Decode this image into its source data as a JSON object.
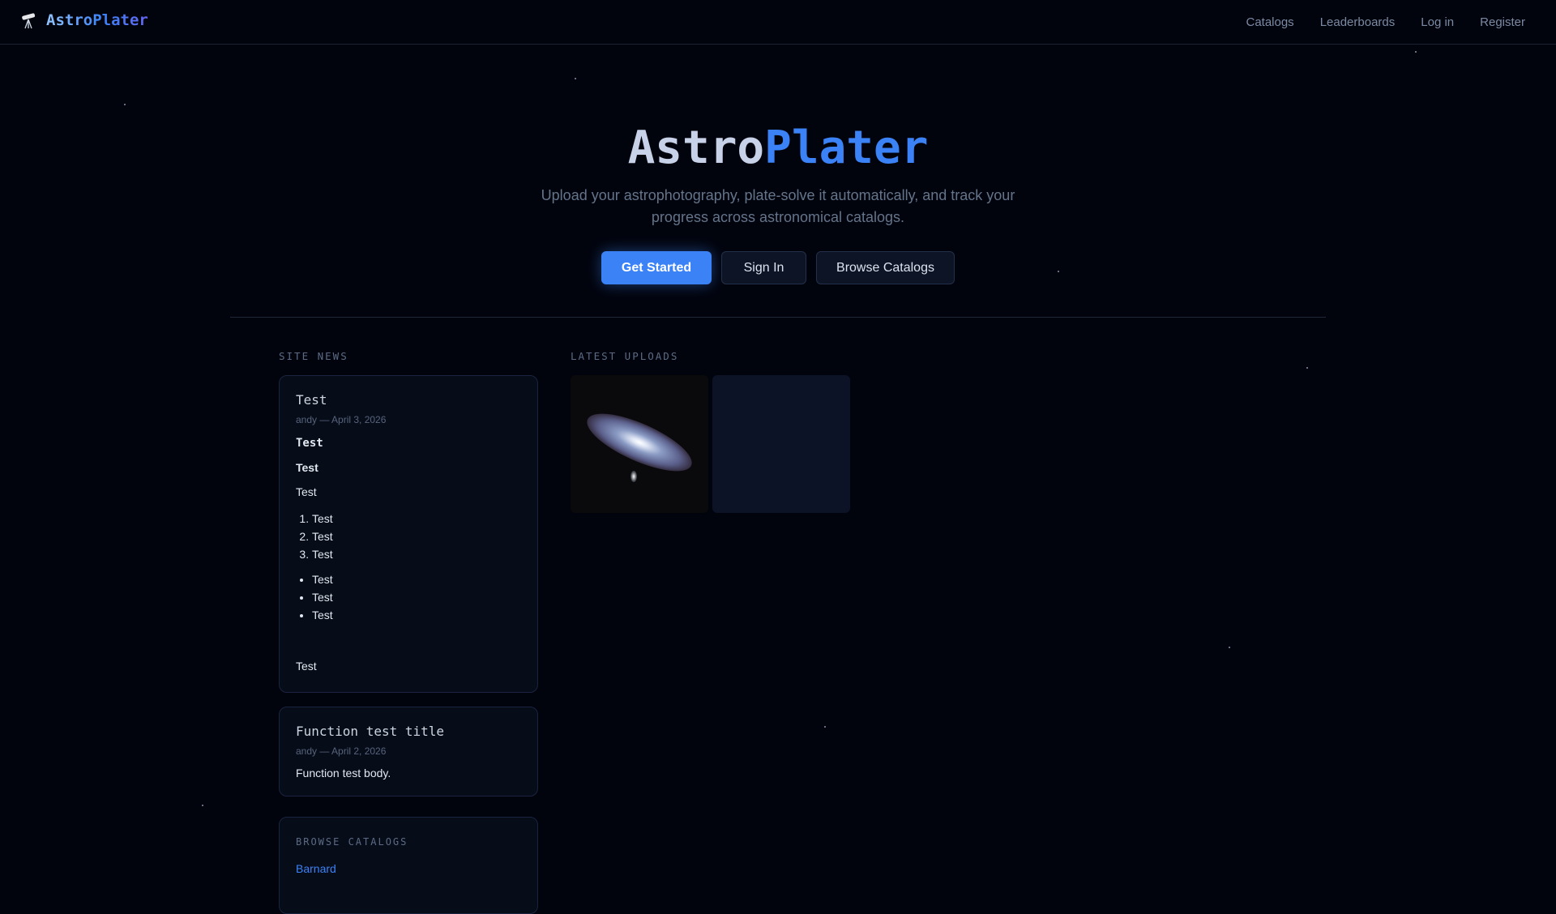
{
  "nav": {
    "brand": "AstroPlater",
    "links": [
      "Catalogs",
      "Leaderboards",
      "Log in",
      "Register"
    ]
  },
  "hero": {
    "title_a": "Astro",
    "title_b": "Plater",
    "subtitle": "Upload your astrophotography, plate-solve it automatically, and track your progress across astronomical catalogs.",
    "get_started": "Get Started",
    "sign_in": "Sign In",
    "browse": "Browse Catalogs"
  },
  "news": {
    "label": "SITE NEWS",
    "posts": [
      {
        "title": "Test",
        "meta": "andy — April 3, 2026",
        "h1": "Test",
        "h2": "Test",
        "p": "Test",
        "ol": [
          "Test",
          "Test",
          "Test"
        ],
        "ul": [
          "Test",
          "Test",
          "Test"
        ],
        "p2": "Test"
      },
      {
        "title": "Function test title",
        "meta": "andy — April 2, 2026",
        "p": "Function test body."
      }
    ]
  },
  "catalogs": {
    "label": "BROWSE CATALOGS",
    "items": [
      "Barnard"
    ]
  },
  "uploads": {
    "label": "LATEST UPLOADS"
  }
}
